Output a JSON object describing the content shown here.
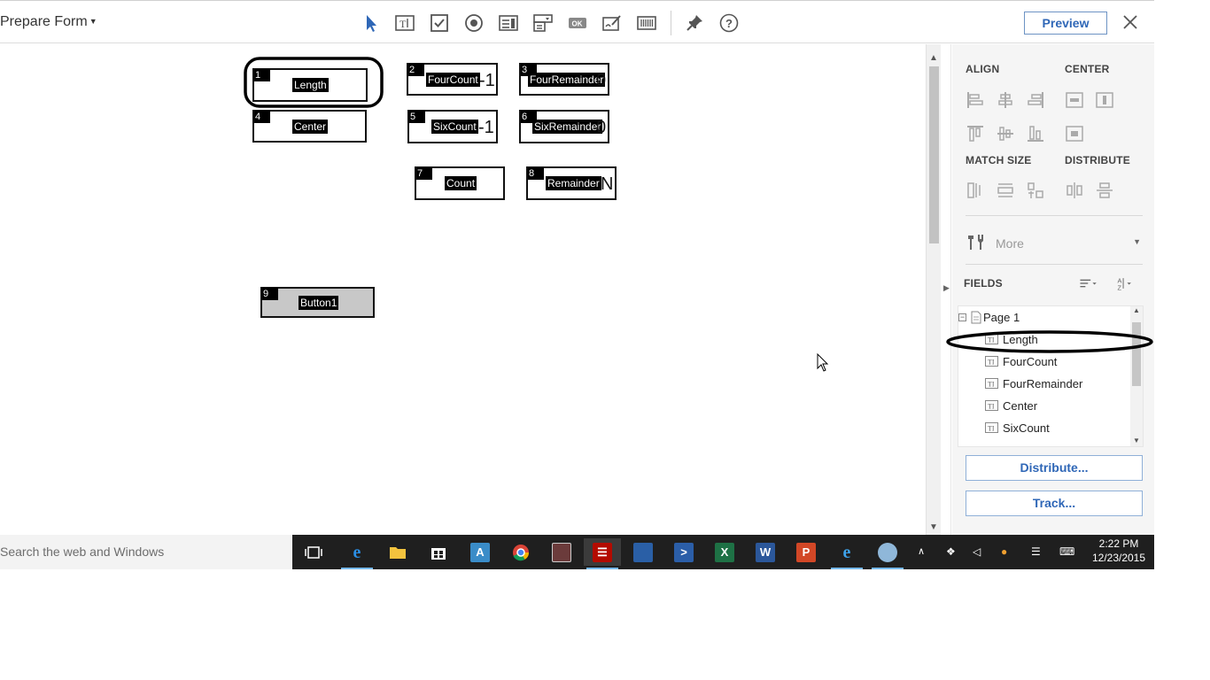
{
  "toolbar": {
    "title": "Prepare Form",
    "preview_label": "Preview",
    "tools": [
      "select-pointer-icon",
      "text-field-icon",
      "checkbox-icon",
      "radio-button-icon",
      "list-box-icon",
      "dropdown-icon",
      "ok-button-icon",
      "signature-icon",
      "barcode-icon",
      "pin-icon",
      "help-icon"
    ]
  },
  "fields": [
    {
      "num": "1",
      "label": "Length",
      "value": ""
    },
    {
      "num": "2",
      "label": "FourCount",
      "value": "-1"
    },
    {
      "num": "3",
      "label": "FourRemainder",
      "value": "0"
    },
    {
      "num": "4",
      "label": "Center",
      "value": ""
    },
    {
      "num": "5",
      "label": "SixCount",
      "value": "-1"
    },
    {
      "num": "6",
      "label": "SixRemainder",
      "value": "0"
    },
    {
      "num": "7",
      "label": "Count",
      "value": ""
    },
    {
      "num": "8",
      "label": "Remainder",
      "value": "N"
    },
    {
      "num": "9",
      "label": "Button1",
      "value": ""
    }
  ],
  "panel": {
    "align": "ALIGN",
    "center": "CENTER",
    "match_size": "MATCH SIZE",
    "distribute": "DISTRIBUTE",
    "more": "More",
    "fields_heading": "FIELDS",
    "tree": {
      "page": "Page 1",
      "items": [
        "Length",
        "FourCount",
        "FourRemainder",
        "Center",
        "SixCount"
      ]
    },
    "distribute_button": "Distribute...",
    "track_button": "Track..."
  },
  "taskbar": {
    "search_placeholder": "Search the web and Windows",
    "apps": [
      "task-view",
      "edge",
      "file-explorer",
      "store",
      "autocad",
      "chrome",
      "media-app",
      "acrobat",
      "remote-desktop",
      "powershell",
      "excel",
      "word",
      "powerpoint",
      "internet-explorer",
      "paint"
    ],
    "time": "2:22 PM",
    "date": "12/23/2015"
  },
  "colors": {
    "accent": "#2f67b7",
    "taskbar": "#1f1f1f",
    "field_border": "#111111"
  }
}
